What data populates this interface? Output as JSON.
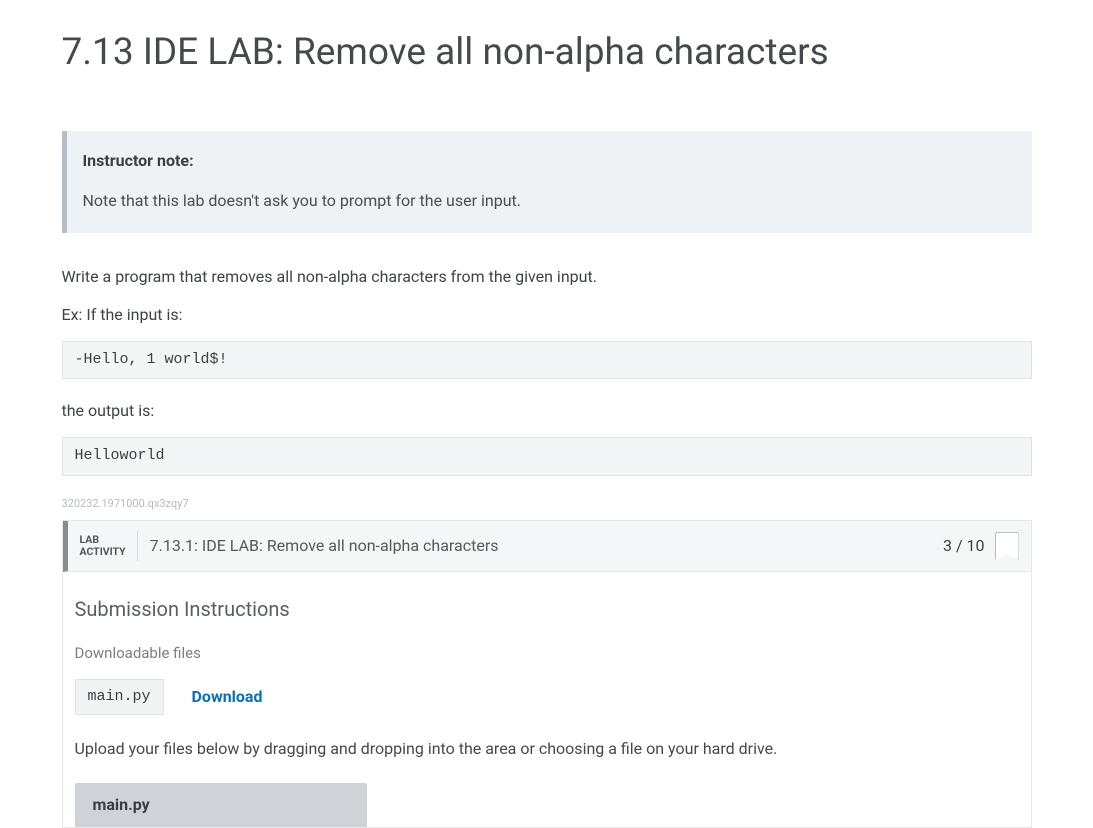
{
  "page": {
    "title": "7.13 IDE LAB: Remove all non-alpha characters"
  },
  "instructor_note": {
    "label": "Instructor note:",
    "body": "Note that this lab doesn't ask you to prompt for the user input."
  },
  "instructions": {
    "p1": "Write a program that removes all non-alpha characters from the given input.",
    "p2": "Ex: If the input is:",
    "code_input": "-Hello, 1 world$!",
    "p3": "the output is:",
    "code_output": "Helloworld"
  },
  "hash": "320232.1971000.qx3zqy7",
  "lab": {
    "badge_line1": "LAB",
    "badge_line2": "ACTIVITY",
    "title": "7.13.1: IDE LAB: Remove all non-alpha characters",
    "score": "3 / 10"
  },
  "submission": {
    "title": "Submission Instructions",
    "downloadable_label": "Downloadable files",
    "file_name": "main.py",
    "download_label": "Download",
    "upload_text": "Upload your files below by dragging and dropping into the area or choosing a file on your hard drive.",
    "upload_tab": "main.py"
  }
}
